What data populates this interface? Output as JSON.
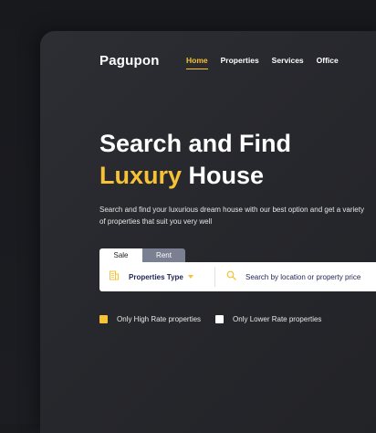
{
  "brand": {
    "logo": "Pagupon"
  },
  "nav": {
    "items": [
      {
        "label": "Home",
        "active": true
      },
      {
        "label": "Properties",
        "active": false
      },
      {
        "label": "Services",
        "active": false
      },
      {
        "label": "Office",
        "active": false
      }
    ]
  },
  "hero": {
    "title_line1": "Search and Find",
    "title_accent": "Luxury",
    "title_rest": "House",
    "description": "Search and find your luxurious dream house with our best option and get a variety of properties that suit you very well"
  },
  "search": {
    "tabs": [
      {
        "label": "Sale",
        "active": true
      },
      {
        "label": "Rent",
        "active": false
      }
    ],
    "type_label": "Properties Type",
    "placeholder": "Search by location or property price",
    "type_icon": "building-icon",
    "search_icon": "search-icon"
  },
  "filters": [
    {
      "label": "Only High Rate properties",
      "checked": true,
      "color": "#f7c234"
    },
    {
      "label": "Only Lower Rate properties",
      "checked": false,
      "color": "#ffffff"
    }
  ],
  "colors": {
    "accent": "#f7c234",
    "background": "#1a1b1f",
    "panel": "#2a2b30",
    "text_dark": "#1e2352",
    "tab_inactive": "#7b7f92"
  }
}
